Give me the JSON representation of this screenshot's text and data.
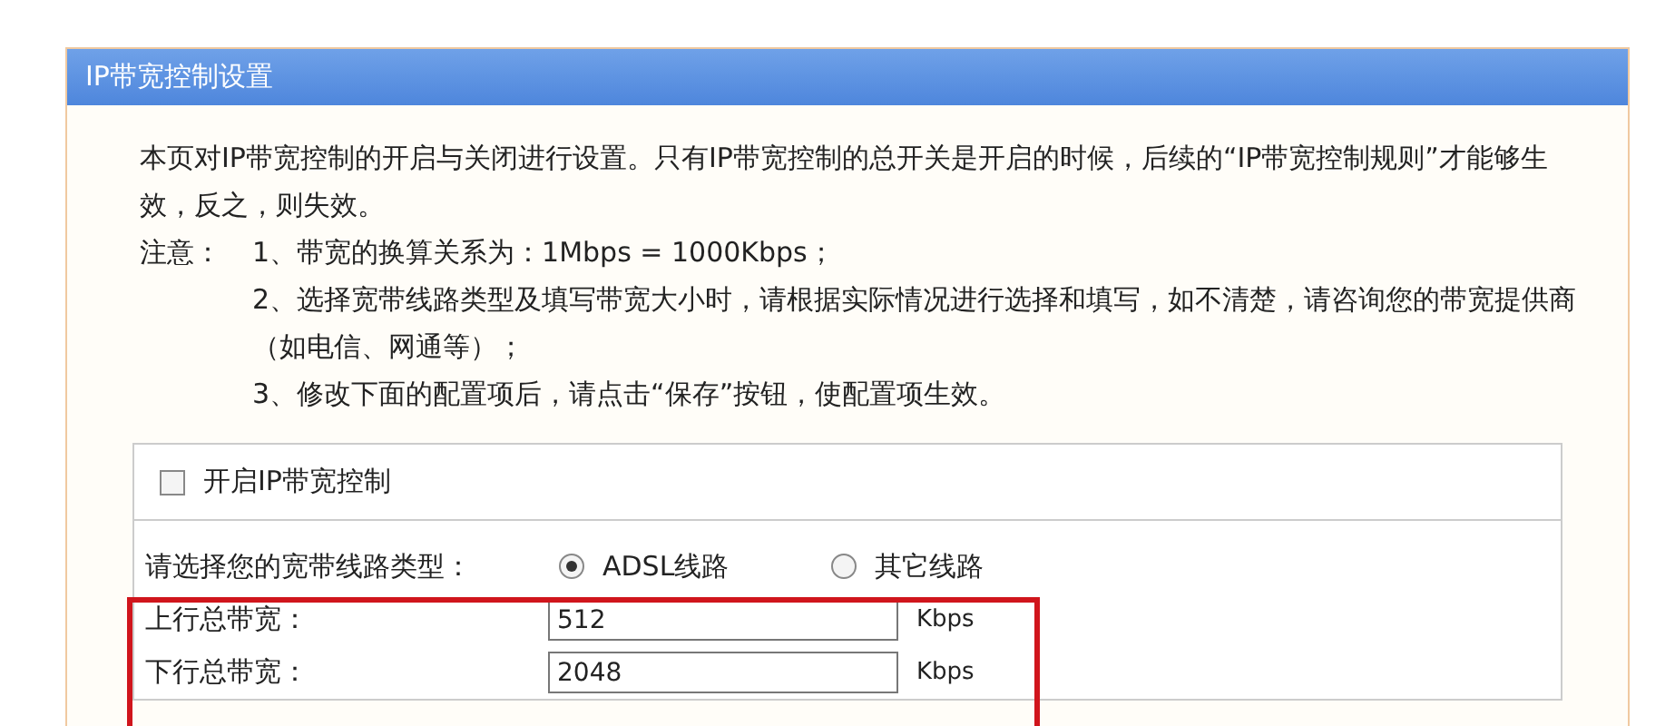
{
  "panel": {
    "title": "IP带宽控制设置",
    "intro": "本页对IP带宽控制的开启与关闭进行设置。只有IP带宽控制的总开关是开启的时候，后续的“IP带宽控制规则”才能够生效，反之，则失效。",
    "notes_label": "注意：",
    "notes": [
      "1、带宽的换算关系为：1Mbps = 1000Kbps；",
      "2、选择宽带线路类型及填写带宽大小时，请根据实际情况进行选择和填写，如不清楚，请咨询您的带宽提供商（如电信、网通等）；",
      "3、修改下面的配置项后，请点击“保存”按钮，使配置项生效。"
    ]
  },
  "enable": {
    "label": "开启IP带宽控制",
    "checked": false
  },
  "line_type": {
    "label": "请选择您的宽带线路类型：",
    "options": [
      {
        "label": "ADSL线路",
        "selected": true
      },
      {
        "label": "其它线路",
        "selected": false
      }
    ]
  },
  "fields": [
    {
      "label": "上行总带宽：",
      "value": "512",
      "unit": "Kbps"
    },
    {
      "label": "下行总带宽：",
      "value": "2048",
      "unit": "Kbps"
    }
  ]
}
